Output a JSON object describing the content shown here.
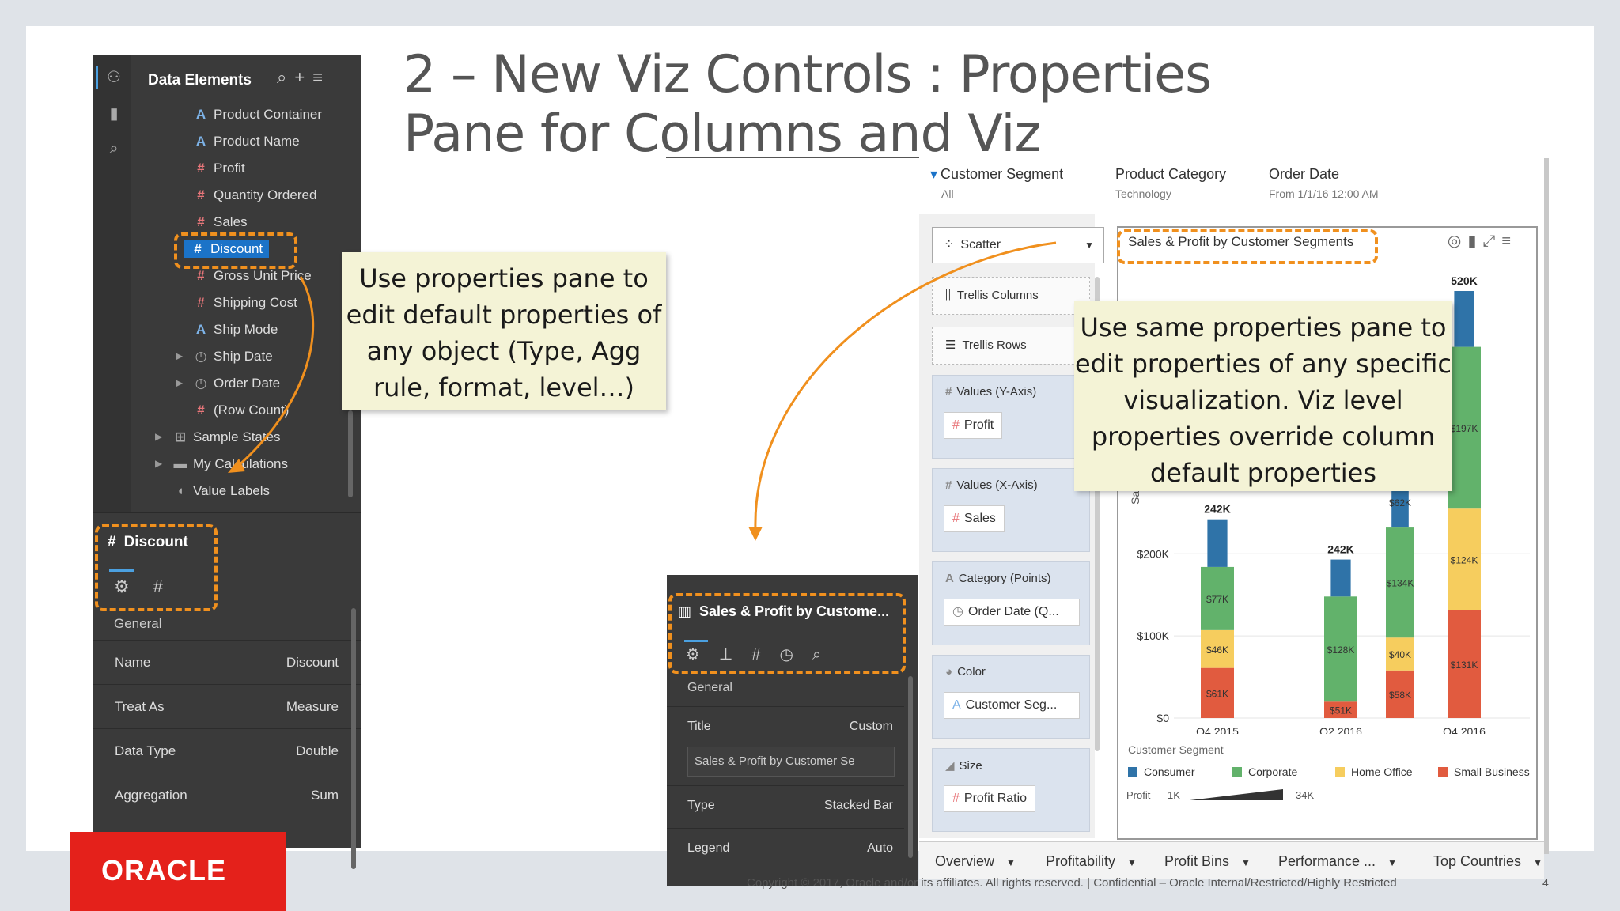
{
  "title_line1": "2 – New Viz Controls : Properties",
  "title_line2": "Pane for Columns and Viz",
  "data_panel": {
    "header": "Data Elements",
    "items": [
      {
        "icon": "A",
        "label": "Product Container"
      },
      {
        "icon": "#",
        "label": "Product Name"
      },
      {
        "icon": "#",
        "label": "Profit"
      },
      {
        "icon": "#",
        "label": "Quantity Ordered"
      },
      {
        "icon": "#",
        "label": "Sales"
      },
      {
        "icon": "#",
        "label": "Discount"
      },
      {
        "icon": "#",
        "label": "Gross Unit Price"
      },
      {
        "icon": "#",
        "label": "Shipping Cost"
      },
      {
        "icon": "A",
        "label": "Ship Mode"
      },
      {
        "icon": "clock",
        "label": "Ship Date"
      },
      {
        "icon": "clock",
        "label": "Order Date"
      },
      {
        "icon": "#",
        "label": "(Row Count)"
      },
      {
        "icon": "table",
        "label": "Sample States"
      },
      {
        "icon": "folder",
        "label": "My Calculations"
      },
      {
        "icon": "tag",
        "label": "Value Labels"
      }
    ],
    "props_title": "Discount",
    "section": "General",
    "props": [
      {
        "key": "Name",
        "value": "Discount"
      },
      {
        "key": "Treat As",
        "value": "Measure"
      },
      {
        "key": "Data Type",
        "value": "Double"
      },
      {
        "key": "Aggregation",
        "value": "Sum"
      }
    ]
  },
  "callout1": "Use properties pane to edit default properties of any object (Type, Agg rule, format, level…)",
  "callout2": "Use same properties pane to edit properties of any specific visualization. Viz level properties override column default properties",
  "viz_panel": {
    "title": "Sales & Profit by Custome...",
    "section": "General",
    "title_key": "Title",
    "title_val": "Custom",
    "title_input": "Sales & Profit by Customer Se",
    "type_key": "Type",
    "type_val": "Stacked Bar",
    "legend_key": "Legend",
    "legend_val": "Auto"
  },
  "filters": [
    {
      "label": "Customer Segment",
      "value": "All"
    },
    {
      "label": "Product Category",
      "value": "Technology"
    },
    {
      "label": "Order Date",
      "value": "From 1/1/16 12:00 AM"
    }
  ],
  "grammar": {
    "viz_type": "Scatter",
    "trellis_cols": "Trellis Columns",
    "trellis_rows": "Trellis Rows",
    "y_axis": "Values (Y-Axis)",
    "y_pill": "Profit",
    "x_axis": "Values (X-Axis)",
    "x_pill": "Sales",
    "category": "Category (Points)",
    "category_pill": "Order Date (Q...",
    "color": "Color",
    "color_pill": "Customer Seg...",
    "size": "Size",
    "size_pill": "Profit Ratio"
  },
  "chart_title": "Sales & Profit by Customer Segments",
  "chart_data": {
    "type": "bar",
    "stacked": true,
    "categories": [
      "Q4 2015",
      "",
      "Q2 2016",
      "",
      "Q4 2016"
    ],
    "series": [
      {
        "name": "Small Business",
        "values": [
          61,
          0,
          20,
          58,
          131
        ],
        "labels": [
          "$61K",
          "",
          "$51K",
          "$58K",
          "$131K"
        ]
      },
      {
        "name": "Home Office",
        "values": [
          46,
          0,
          0,
          40,
          124
        ],
        "labels": [
          "$46K",
          "",
          "",
          "$40K",
          "$124K"
        ]
      },
      {
        "name": "Corporate",
        "values": [
          77,
          0,
          128,
          134,
          197
        ],
        "labels": [
          "$77K",
          "",
          "$128K",
          "$134K",
          "$197K"
        ]
      },
      {
        "name": "Consumer",
        "values": [
          58,
          0,
          45,
          62,
          68
        ],
        "labels": [
          "",
          "",
          "",
          "$62K",
          ""
        ]
      }
    ],
    "totals": [
      "242K",
      "",
      "242K",
      "",
      "520K"
    ],
    "y_ticks": [
      "$0",
      "$100K",
      "$200K"
    ],
    "ylabel": "Sale",
    "ylim": [
      0,
      520
    ],
    "colors": {
      "Consumer": "#2f73a8",
      "Corporate": "#62b26b",
      "Home Office": "#f6cd5e",
      "Small Business": "#e15b3f"
    }
  },
  "legend": {
    "title": "Customer Segment",
    "items": [
      "Consumer",
      "Corporate",
      "Home Office",
      "Small Business"
    ],
    "size_label": "Profit",
    "size_min": "1K",
    "size_max": "34K"
  },
  "bottom_tabs": [
    "Overview",
    "Profitability",
    "Profit Bins",
    "Performance ...",
    "Top Countries"
  ],
  "footer": "Copyright © 2017, Oracle and/or its affiliates. All rights reserved. | Confidential – Oracle Internal/Restricted/Highly Restricted",
  "slide_number": "4",
  "logo": "ORACLE"
}
